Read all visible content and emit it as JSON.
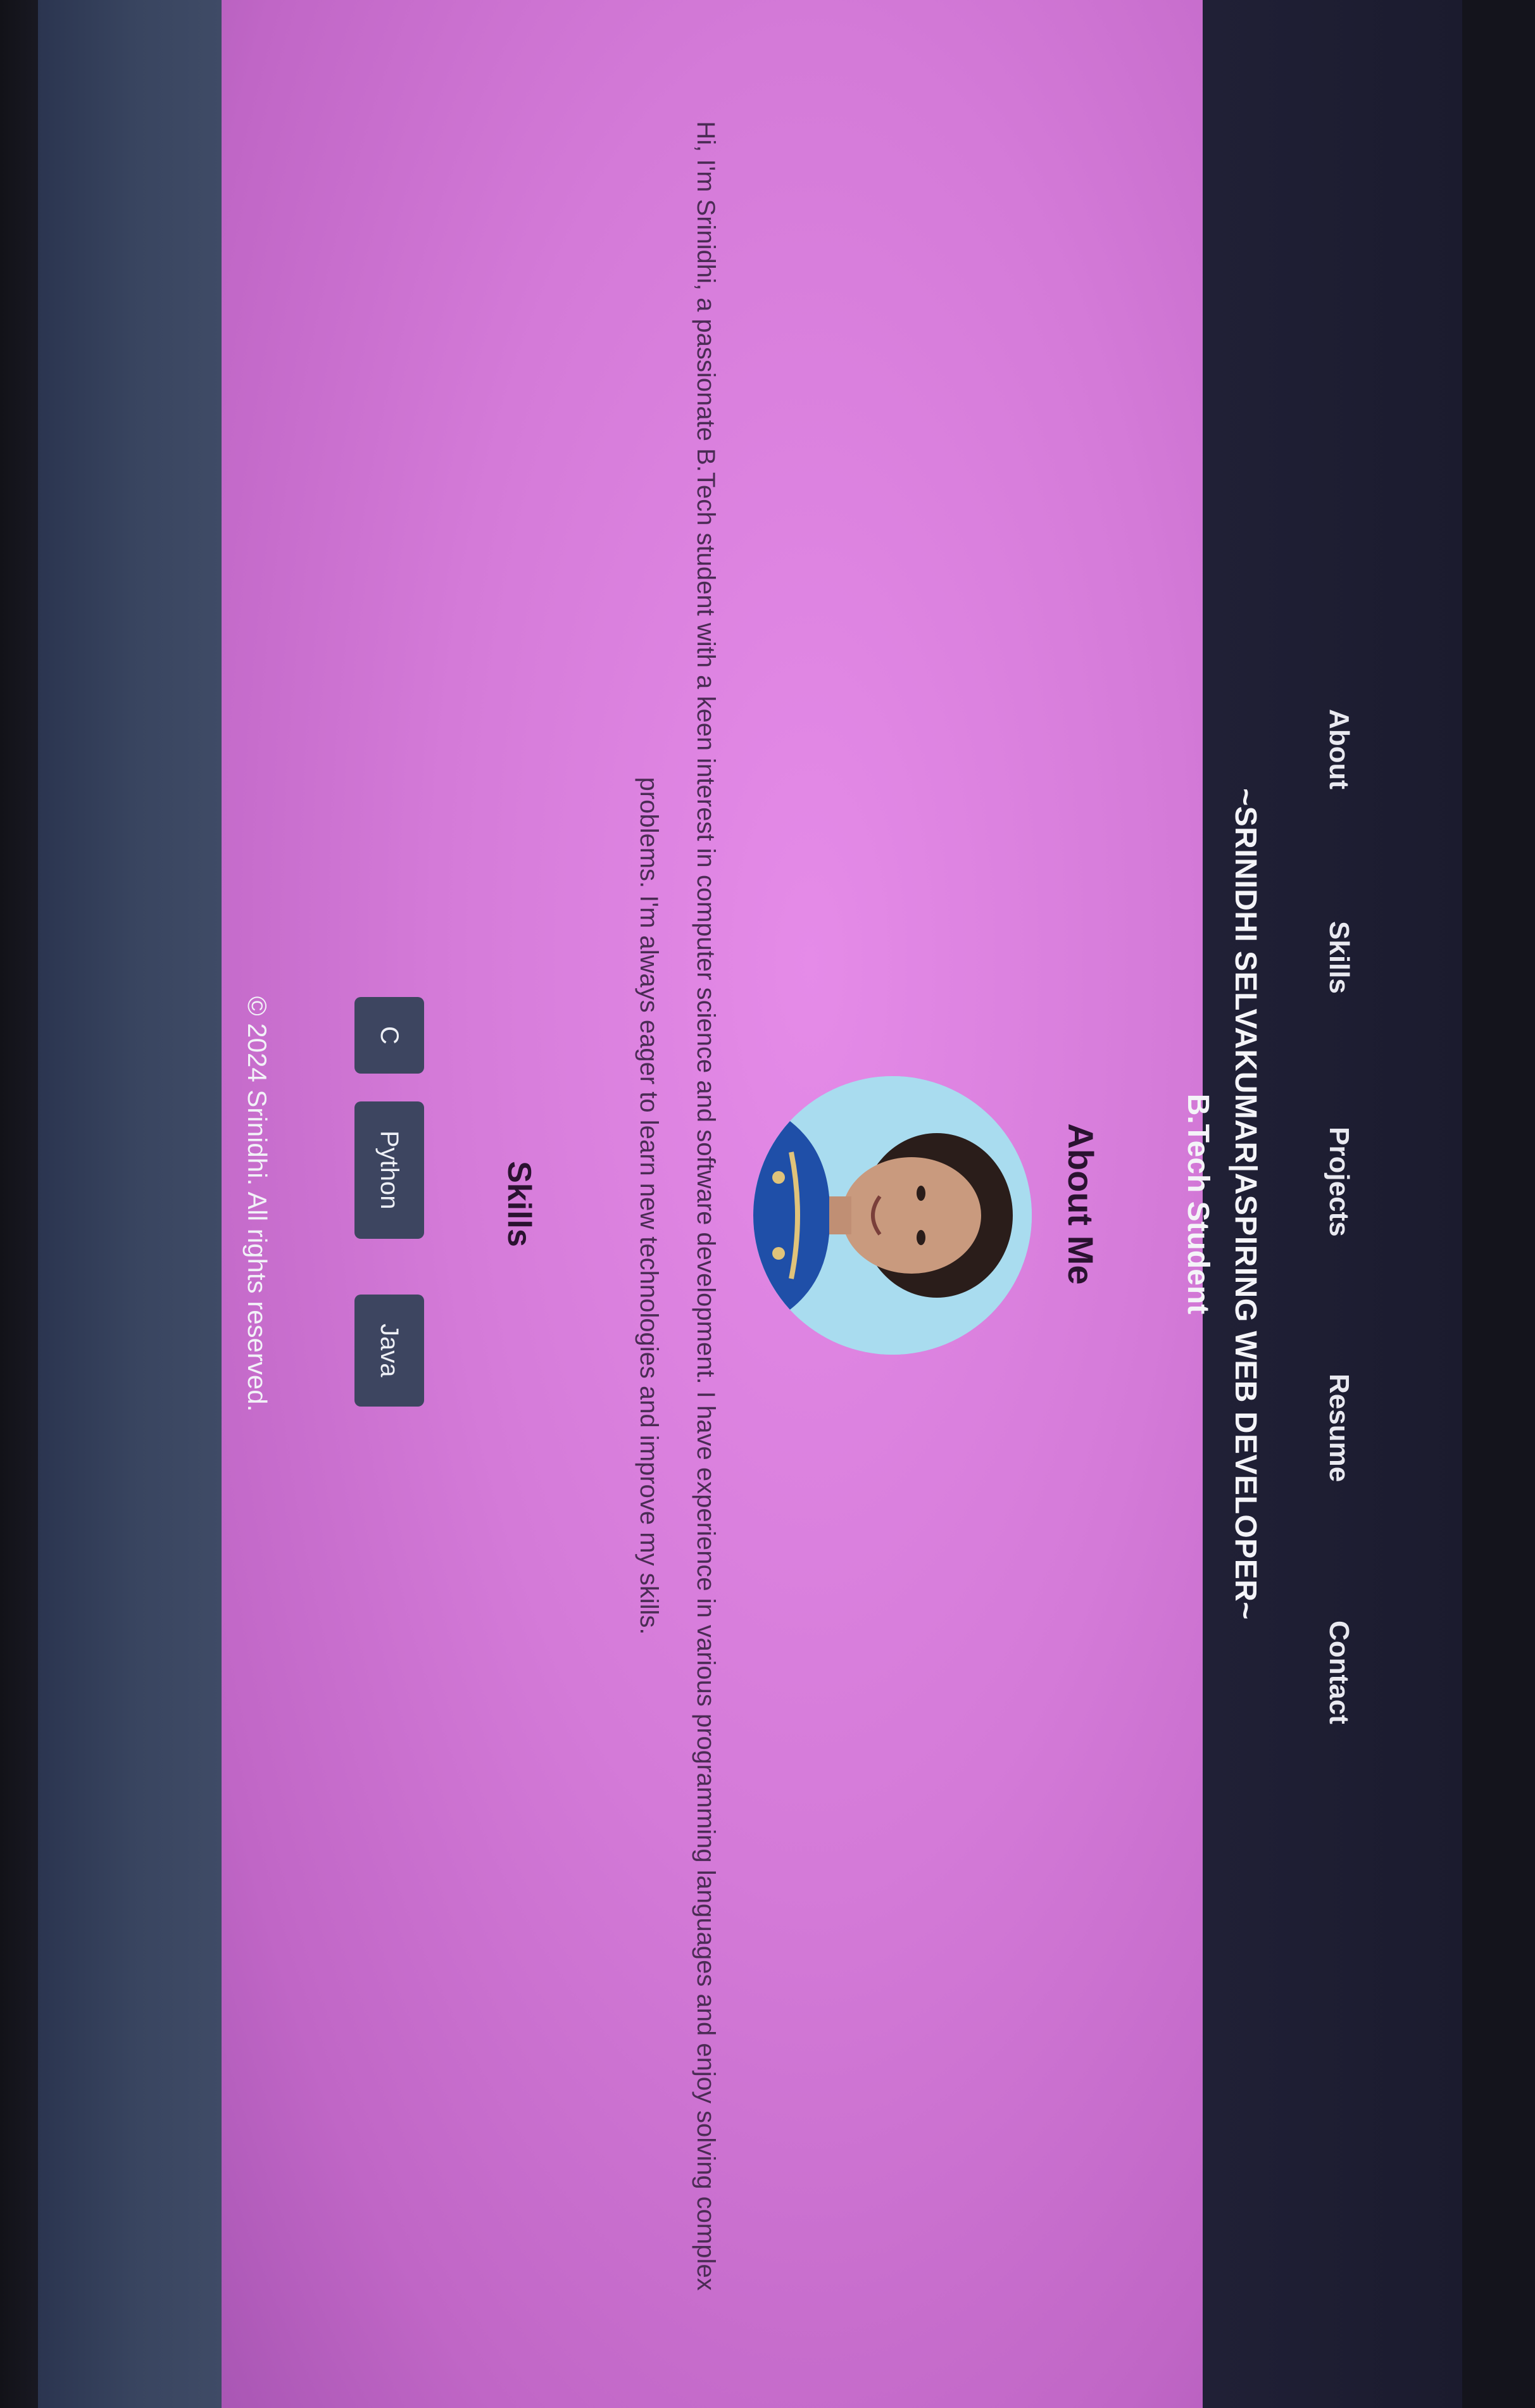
{
  "nav": {
    "items": [
      {
        "label": "About"
      },
      {
        "label": "Skills"
      },
      {
        "label": "Projects"
      },
      {
        "label": "Resume"
      },
      {
        "label": "Contact"
      }
    ]
  },
  "hero": {
    "title": "~SRINIDHI SELVAKUMAR|ASPIRING WEB DEVELOPER~",
    "subtitle": "B.Tech Student"
  },
  "about": {
    "heading": "About Me",
    "avatar_icon": "profile-photo",
    "text": "Hi, I'm Srinidhi, a passionate B.Tech student with a keen interest in computer science and software development. I have experience in various programming languages and enjoy solving complex problems. I'm always eager to learn new technologies and improve my skills."
  },
  "skills": {
    "heading": "Skills",
    "items": [
      "C",
      "Python",
      "Java"
    ]
  },
  "footer": {
    "text": "© 2024 Srinidhi. All rights reserved."
  },
  "colors": {
    "header_bg": "#1f1f33",
    "content_bg": "#d47ad8",
    "footer_bg": "#394560",
    "skill_bg": "#3d4560"
  }
}
